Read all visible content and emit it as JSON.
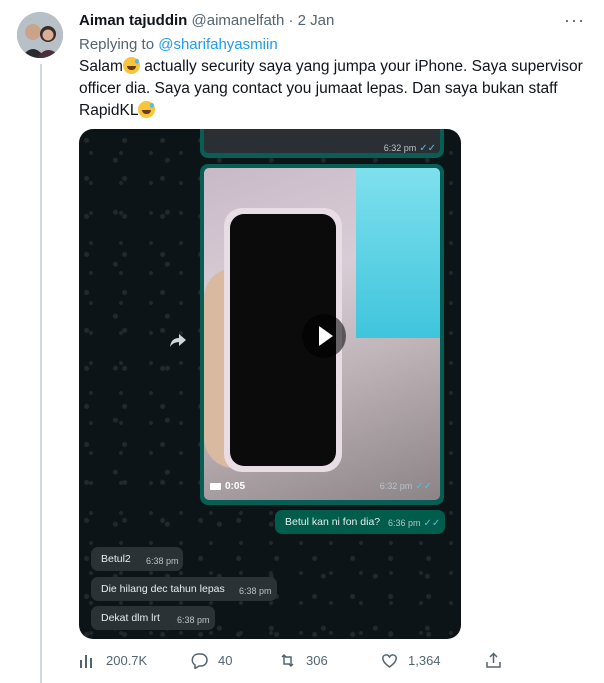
{
  "tweet": {
    "author_name": "Aiman tajuddin",
    "author_handle": "@aimanelfath",
    "separator": "·",
    "date": "2 Jan",
    "more_label": "···",
    "replying_prefix": "Replying to",
    "replying_to": "@sharifahyasmiin",
    "text_parts": [
      "Salam",
      " actually security saya yang jumpa your iPhone. Saya supervisor officer dia. Saya yang contact you jumaat lepas. Dan saya bukan staff RapidKL"
    ]
  },
  "media": {
    "top_bubble_time": "6:32 pm",
    "video_duration": "0:05",
    "video_time": "6:32 pm",
    "outgoing_message": "Betul kan ni fon dia?",
    "outgoing_time": "6:36 pm",
    "incoming_messages": [
      {
        "text": "Betul2",
        "time": "6:38 pm"
      },
      {
        "text": "Die hilang dec tahun lepas",
        "time": "6:38 pm"
      },
      {
        "text": "Dekat dlm lrt",
        "time": "6:38 pm"
      }
    ]
  },
  "actions": {
    "views": "200.7K",
    "replies": "40",
    "retweets": "306",
    "likes": "1,364"
  },
  "icons": [
    "analytics-icon",
    "reply-icon",
    "retweet-icon",
    "like-icon",
    "share-icon",
    "more-icon",
    "play-icon",
    "forward-icon",
    "video-camera-icon"
  ],
  "colors": {
    "link": "#1d9bf0",
    "secondary_text": "#536471",
    "whatsapp_out": "#005c4b"
  }
}
